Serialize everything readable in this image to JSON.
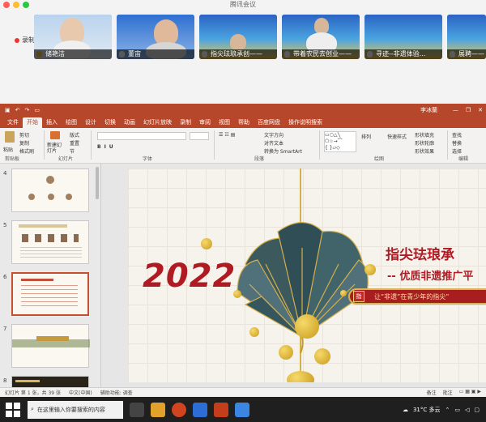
{
  "meeting": {
    "window_title": "腾讯会议",
    "recording_label": "录制中",
    "participants": [
      {
        "name": "储艳洁"
      },
      {
        "name": "董宙"
      },
      {
        "name": "指尖珐琅承创——"
      },
      {
        "name": "带着农民去创业——"
      },
      {
        "name": "寻迹--非遗体验..."
      },
      {
        "name": "展聘——"
      }
    ]
  },
  "ppt": {
    "titlebar_user": "李冰蘭",
    "menus": [
      "文件",
      "开始",
      "插入",
      "绘图",
      "设计",
      "切换",
      "动画",
      "幻灯片放映",
      "录制",
      "审阅",
      "视图",
      "帮助",
      "百度网盘",
      "操作说明搜索"
    ],
    "ribbon": {
      "paste": "粘贴",
      "cut": "剪切",
      "copy": "复制",
      "format_painter": "格式刷",
      "new_slide": "新建幻灯片",
      "layout": "版式",
      "reset": "重置",
      "section": "节",
      "groups": [
        "剪贴板",
        "幻灯片",
        "字体",
        "段落",
        "绘图",
        "编辑"
      ],
      "text_direction": "文字方向",
      "align_text": "对齐文本",
      "smartart": "转换为 SmartArt",
      "arrange": "排列",
      "quick_styles": "快速样式",
      "shape_fill": "形状填充",
      "shape_outline": "形状轮廓",
      "shape_effects": "形状效果",
      "find": "查找",
      "replace": "替换",
      "select": "选择"
    },
    "thumb_numbers": [
      "4",
      "5",
      "6",
      "7",
      "8"
    ],
    "slide": {
      "year": "2022",
      "title": "指尖珐琅承",
      "subtitle": "-- 优质非遗推广平",
      "banner": "让“非遗”在青少年的指尖”",
      "seal": "指"
    },
    "status": {
      "slide_info": "幻灯片 第 1 张，共 39 张",
      "language": "中文(中国)",
      "accessibility": "辅助功能: 调查",
      "notes": "备注",
      "comments": "批注"
    }
  },
  "taskbar": {
    "search_placeholder": "在这里输入你要搜索的内容",
    "weather": "31°C 多云"
  }
}
